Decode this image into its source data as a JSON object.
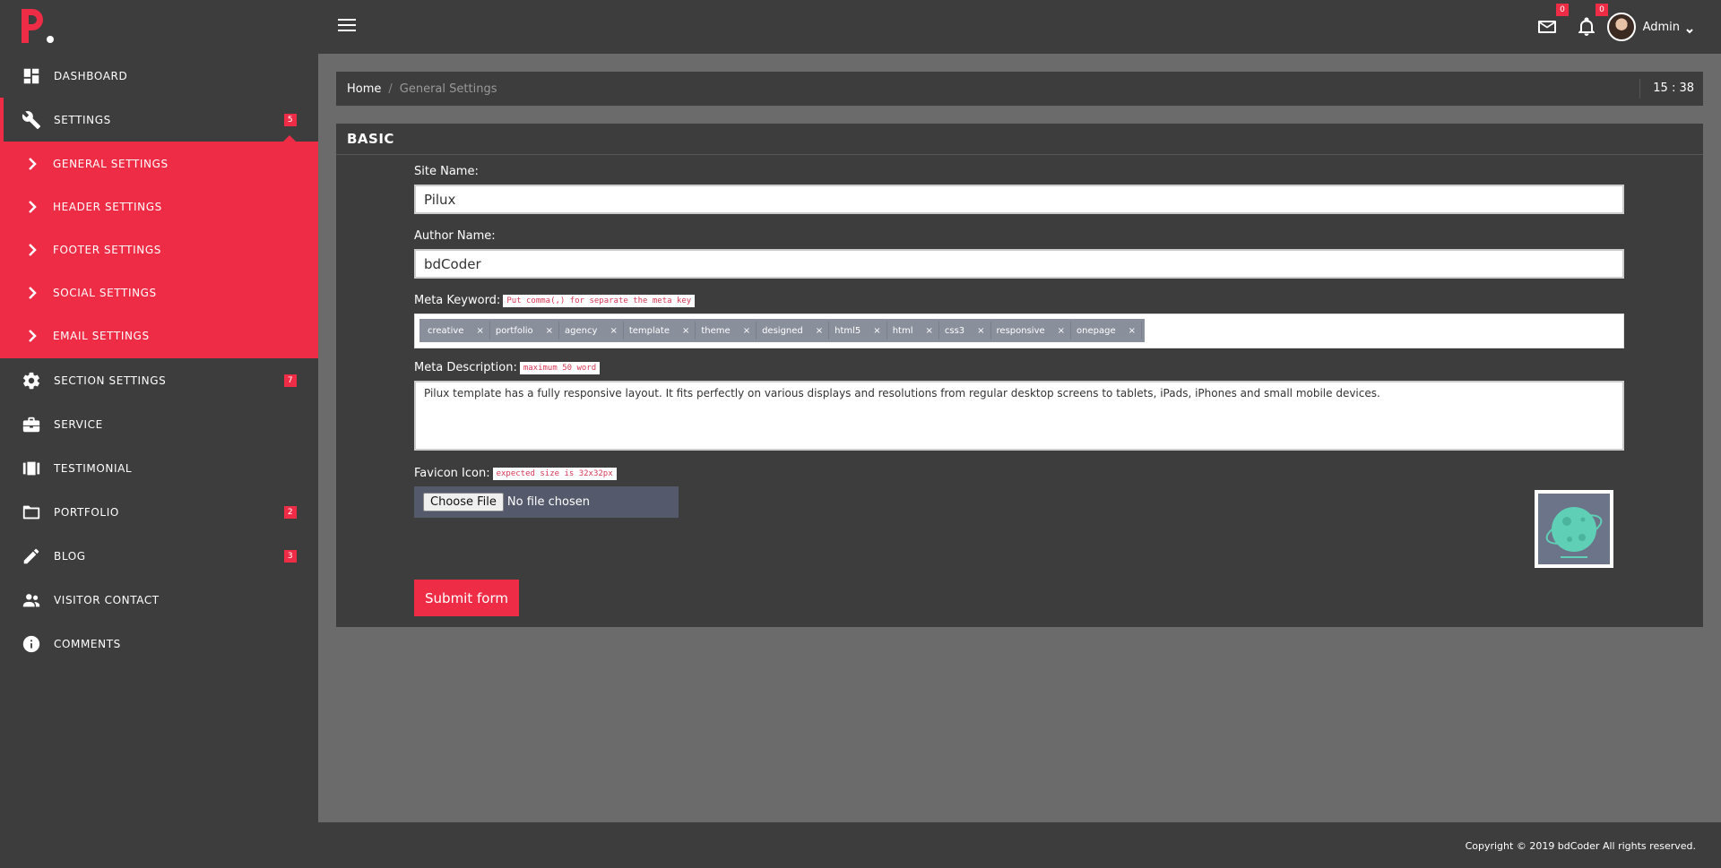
{
  "logo": {
    "letter": "P"
  },
  "sidebar": {
    "items": [
      {
        "label": "DASHBOARD",
        "icon": "dashboard-icon"
      },
      {
        "label": "SETTINGS",
        "icon": "wrench-icon",
        "badge": "5"
      },
      {
        "label": "SECTION SETTINGS",
        "icon": "gear-icon",
        "badge": "7"
      },
      {
        "label": "SERVICE",
        "icon": "briefcase-icon"
      },
      {
        "label": "TESTIMONIAL",
        "icon": "film-icon"
      },
      {
        "label": "PORTFOLIO",
        "icon": "folder-icon",
        "badge": "2"
      },
      {
        "label": "BLOG",
        "icon": "pencil-icon",
        "badge": "3"
      },
      {
        "label": "VISITOR CONTACT",
        "icon": "people-icon"
      },
      {
        "label": "COMMENTS",
        "icon": "info-icon"
      }
    ],
    "submenu": [
      {
        "label": "GENERAL SETTINGS"
      },
      {
        "label": "HEADER SETTINGS"
      },
      {
        "label": "FOOTER SETTINGS"
      },
      {
        "label": "SOCIAL SETTINGS"
      },
      {
        "label": "EMAIL SETTINGS"
      }
    ]
  },
  "topbar": {
    "mail_badge": "0",
    "notification_badge": "0",
    "user_name": "Admin"
  },
  "breadcrumb": {
    "home": "Home",
    "separator": "/",
    "current": "General Settings",
    "clock": "15 : 38"
  },
  "card": {
    "title": "BASIC",
    "site_name": {
      "label": "Site Name:",
      "value": "Pilux"
    },
    "author_name": {
      "label": "Author Name:",
      "value": "bdCoder"
    },
    "meta_keyword": {
      "label": "Meta Keyword:",
      "hint": "Put comma(,) for separate the meta key",
      "tags": [
        "creative",
        "portfolio",
        "agency",
        "template",
        "theme",
        "designed",
        "html5",
        "html",
        "css3",
        "responsive",
        "onepage"
      ]
    },
    "meta_description": {
      "label": "Meta Description:",
      "hint": "maximum 50 word",
      "value": "Pilux template has a fully responsive layout. It fits perfectly on various displays and resolutions from regular desktop screens to tablets, iPads, iPhones and small mobile devices."
    },
    "favicon": {
      "label": "Favicon Icon:",
      "hint": "expected size is 32x32px",
      "button": "Choose File",
      "status": "No file chosen"
    },
    "submit_label": "Submit form"
  },
  "footer": {
    "copyright": "Copyright © 2019 bdCoder All rights reserved."
  },
  "colors": {
    "accent": "#ef2c46",
    "sidebar_bg": "#3d3d3d",
    "page_bg": "#6b6b6b"
  }
}
